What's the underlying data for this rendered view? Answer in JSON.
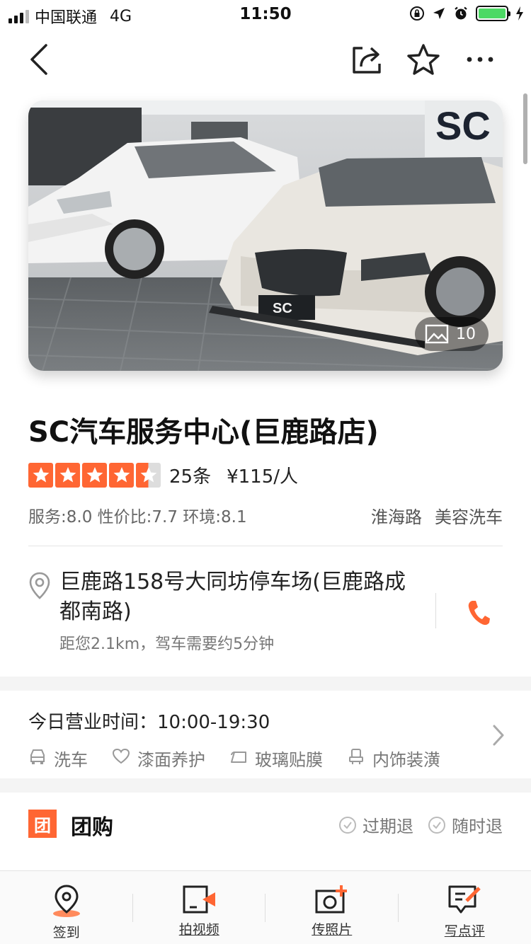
{
  "status_bar": {
    "carrier": "中国联通",
    "network": "4G",
    "time": "11:50"
  },
  "shop": {
    "name": "SC汽车服务中心(巨鹿路店)",
    "rating": 4.5,
    "reviews": "25条",
    "price": "¥115/人",
    "scores": "服务:8.0 性价比:7.7 环境:8.1",
    "area": "淮海路",
    "category": "美容洗车",
    "photo_count": "10"
  },
  "address": {
    "line": "巨鹿路158号大同坊停车场(巨鹿路成都南路)",
    "distance": "距您2.1km，驾车需要约5分钟"
  },
  "hours": {
    "text": "今日营业时间：10:00-19:30",
    "services": [
      {
        "icon": "car-icon",
        "label": "洗车"
      },
      {
        "icon": "heart-icon",
        "label": "漆面养护"
      },
      {
        "icon": "film-icon",
        "label": "玻璃贴膜"
      },
      {
        "icon": "seat-icon",
        "label": "内饰装潢"
      }
    ]
  },
  "group_buy": {
    "badge": "团",
    "title": "团购",
    "tags": [
      "过期退",
      "随时退"
    ]
  },
  "bottom_bar": {
    "items": [
      "签到",
      "拍视频",
      "传照片",
      "写点评"
    ]
  },
  "colors": {
    "accent": "#ff6633",
    "star_off": "#dddddd",
    "battery": "#4cd964"
  }
}
